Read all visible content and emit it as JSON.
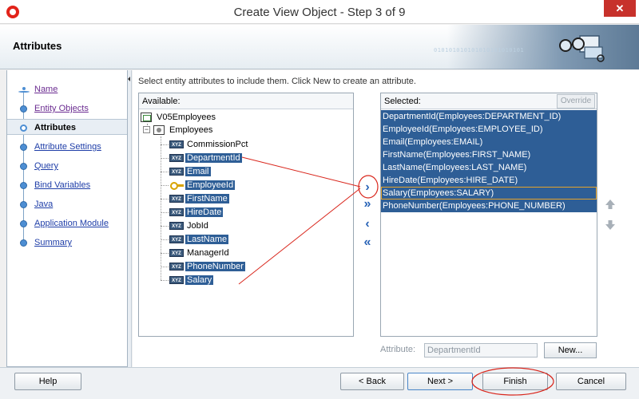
{
  "window": {
    "title": "Create View Object - Step 3 of 9",
    "close_label": "✕"
  },
  "header": {
    "title": "Attributes",
    "binary": "010101010101010101010101"
  },
  "nav": {
    "items": [
      {
        "label": "Name",
        "state": "visited"
      },
      {
        "label": "Entity Objects",
        "state": "visited"
      },
      {
        "label": "Attributes",
        "state": "current"
      },
      {
        "label": "Attribute Settings",
        "state": "link"
      },
      {
        "label": "Query",
        "state": "link"
      },
      {
        "label": "Bind Variables",
        "state": "link"
      },
      {
        "label": "Java",
        "state": "link"
      },
      {
        "label": "Application Module",
        "state": "link"
      },
      {
        "label": "Summary",
        "state": "link"
      }
    ]
  },
  "main": {
    "instruction": "Select entity attributes to include them.  Click New to create an attribute.",
    "available": {
      "label": "Available:",
      "root": "V05Employees",
      "entity": "Employees",
      "attributes": [
        {
          "name": "CommissionPct",
          "selected": false,
          "icon": "xyz"
        },
        {
          "name": "DepartmentId",
          "selected": true,
          "icon": "xyz"
        },
        {
          "name": "Email",
          "selected": true,
          "icon": "xyz"
        },
        {
          "name": "EmployeeId",
          "selected": true,
          "icon": "key"
        },
        {
          "name": "FirstName",
          "selected": true,
          "icon": "xyz"
        },
        {
          "name": "HireDate",
          "selected": true,
          "icon": "xyz"
        },
        {
          "name": "JobId",
          "selected": false,
          "icon": "xyz"
        },
        {
          "name": "LastName",
          "selected": true,
          "icon": "xyz"
        },
        {
          "name": "ManagerId",
          "selected": false,
          "icon": "xyz"
        },
        {
          "name": "PhoneNumber",
          "selected": true,
          "icon": "xyz"
        },
        {
          "name": "Salary",
          "selected": true,
          "icon": "xyz"
        }
      ],
      "xyz_badge": "XYZ"
    },
    "selected": {
      "label": "Selected:",
      "override_label": "Override",
      "items": [
        "DepartmentId(Employees:DEPARTMENT_ID)",
        "EmployeeId(Employees:EMPLOYEE_ID)",
        "Email(Employees:EMAIL)",
        "FirstName(Employees:FIRST_NAME)",
        "LastName(Employees:LAST_NAME)",
        "HireDate(Employees:HIRE_DATE)",
        "Salary(Employees:SALARY)",
        "PhoneNumber(Employees:PHONE_NUMBER)"
      ]
    },
    "shuttle": {
      "move_one": "›",
      "move_all": "»",
      "remove_one": "‹",
      "remove_all": "«"
    },
    "attribute_label": "Attribute:",
    "attribute_value": "DepartmentId",
    "new_label": "New..."
  },
  "footer": {
    "help": "Help",
    "back": "< Back",
    "next": "Next >",
    "finish": "Finish",
    "cancel": "Cancel"
  },
  "colors": {
    "selection": "#2e5e96",
    "annotation": "#d9261c",
    "accent": "#2a64b7"
  }
}
